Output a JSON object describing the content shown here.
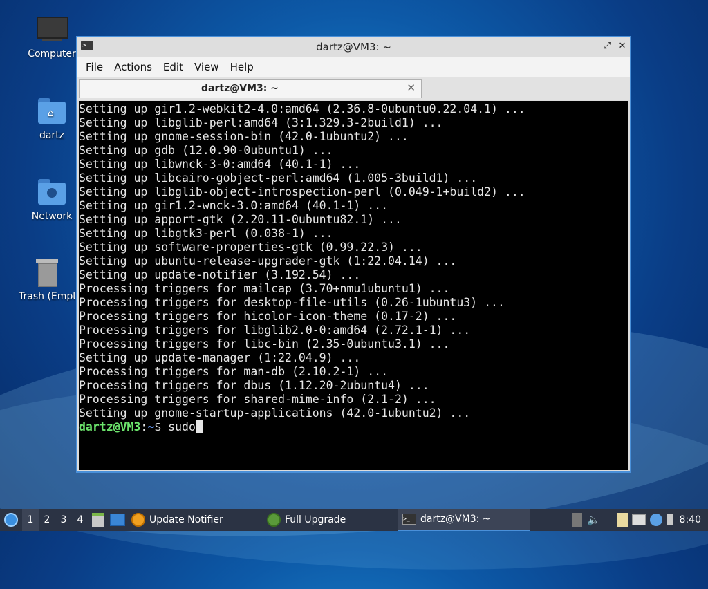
{
  "desktop": {
    "icons": [
      {
        "label": "Computer"
      },
      {
        "label": "dartz"
      },
      {
        "label": "Network"
      },
      {
        "label": "Trash (Empty)"
      }
    ]
  },
  "window": {
    "title": "dartz@VM3: ~",
    "controls": {
      "minimize": "–",
      "maximize": "⤢",
      "close": "✕"
    },
    "menu": [
      "File",
      "Actions",
      "Edit",
      "View",
      "Help"
    ],
    "tab": {
      "title": "dartz@VM3: ~",
      "close": "✕"
    }
  },
  "terminal": {
    "lines": [
      "Setting up gir1.2-webkit2-4.0:amd64 (2.36.8-0ubuntu0.22.04.1) ...",
      "Setting up libglib-perl:amd64 (3:1.329.3-2build1) ...",
      "Setting up gnome-session-bin (42.0-1ubuntu2) ...",
      "Setting up gdb (12.0.90-0ubuntu1) ...",
      "Setting up libwnck-3-0:amd64 (40.1-1) ...",
      "Setting up libcairo-gobject-perl:amd64 (1.005-3build1) ...",
      "Setting up libglib-object-introspection-perl (0.049-1+build2) ...",
      "Setting up gir1.2-wnck-3.0:amd64 (40.1-1) ...",
      "Setting up apport-gtk (2.20.11-0ubuntu82.1) ...",
      "Setting up libgtk3-perl (0.038-1) ...",
      "Setting up software-properties-gtk (0.99.22.3) ...",
      "Setting up ubuntu-release-upgrader-gtk (1:22.04.14) ...",
      "Setting up update-notifier (3.192.54) ...",
      "Processing triggers for mailcap (3.70+nmu1ubuntu1) ...",
      "Processing triggers for desktop-file-utils (0.26-1ubuntu3) ...",
      "Processing triggers for hicolor-icon-theme (0.17-2) ...",
      "Processing triggers for libglib2.0-0:amd64 (2.72.1-1) ...",
      "Processing triggers for libc-bin (2.35-0ubuntu3.1) ...",
      "Setting up update-manager (1:22.04.9) ...",
      "Processing triggers for man-db (2.10.2-1) ...",
      "Processing triggers for dbus (1.12.20-2ubuntu4) ...",
      "Processing triggers for shared-mime-info (2.1-2) ...",
      "Setting up gnome-startup-applications (42.0-1ubuntu2) ..."
    ],
    "prompt": {
      "user_host": "dartz@VM3",
      "separator": ":",
      "path": "~",
      "symbol": "$ ",
      "command": "sudo"
    }
  },
  "taskbar": {
    "workspaces": [
      "1",
      "2",
      "3",
      "4"
    ],
    "active_workspace": "1",
    "tasks": [
      {
        "label": "Update Notifier"
      },
      {
        "label": "Full Upgrade"
      },
      {
        "label": "dartz@VM3: ~"
      }
    ],
    "clock": "8:40"
  },
  "colors": {
    "accent": "#4a90d9",
    "prompt_user": "#6ce46c",
    "prompt_path": "#6aa0ff",
    "taskbar_bg": "#2b3344"
  }
}
